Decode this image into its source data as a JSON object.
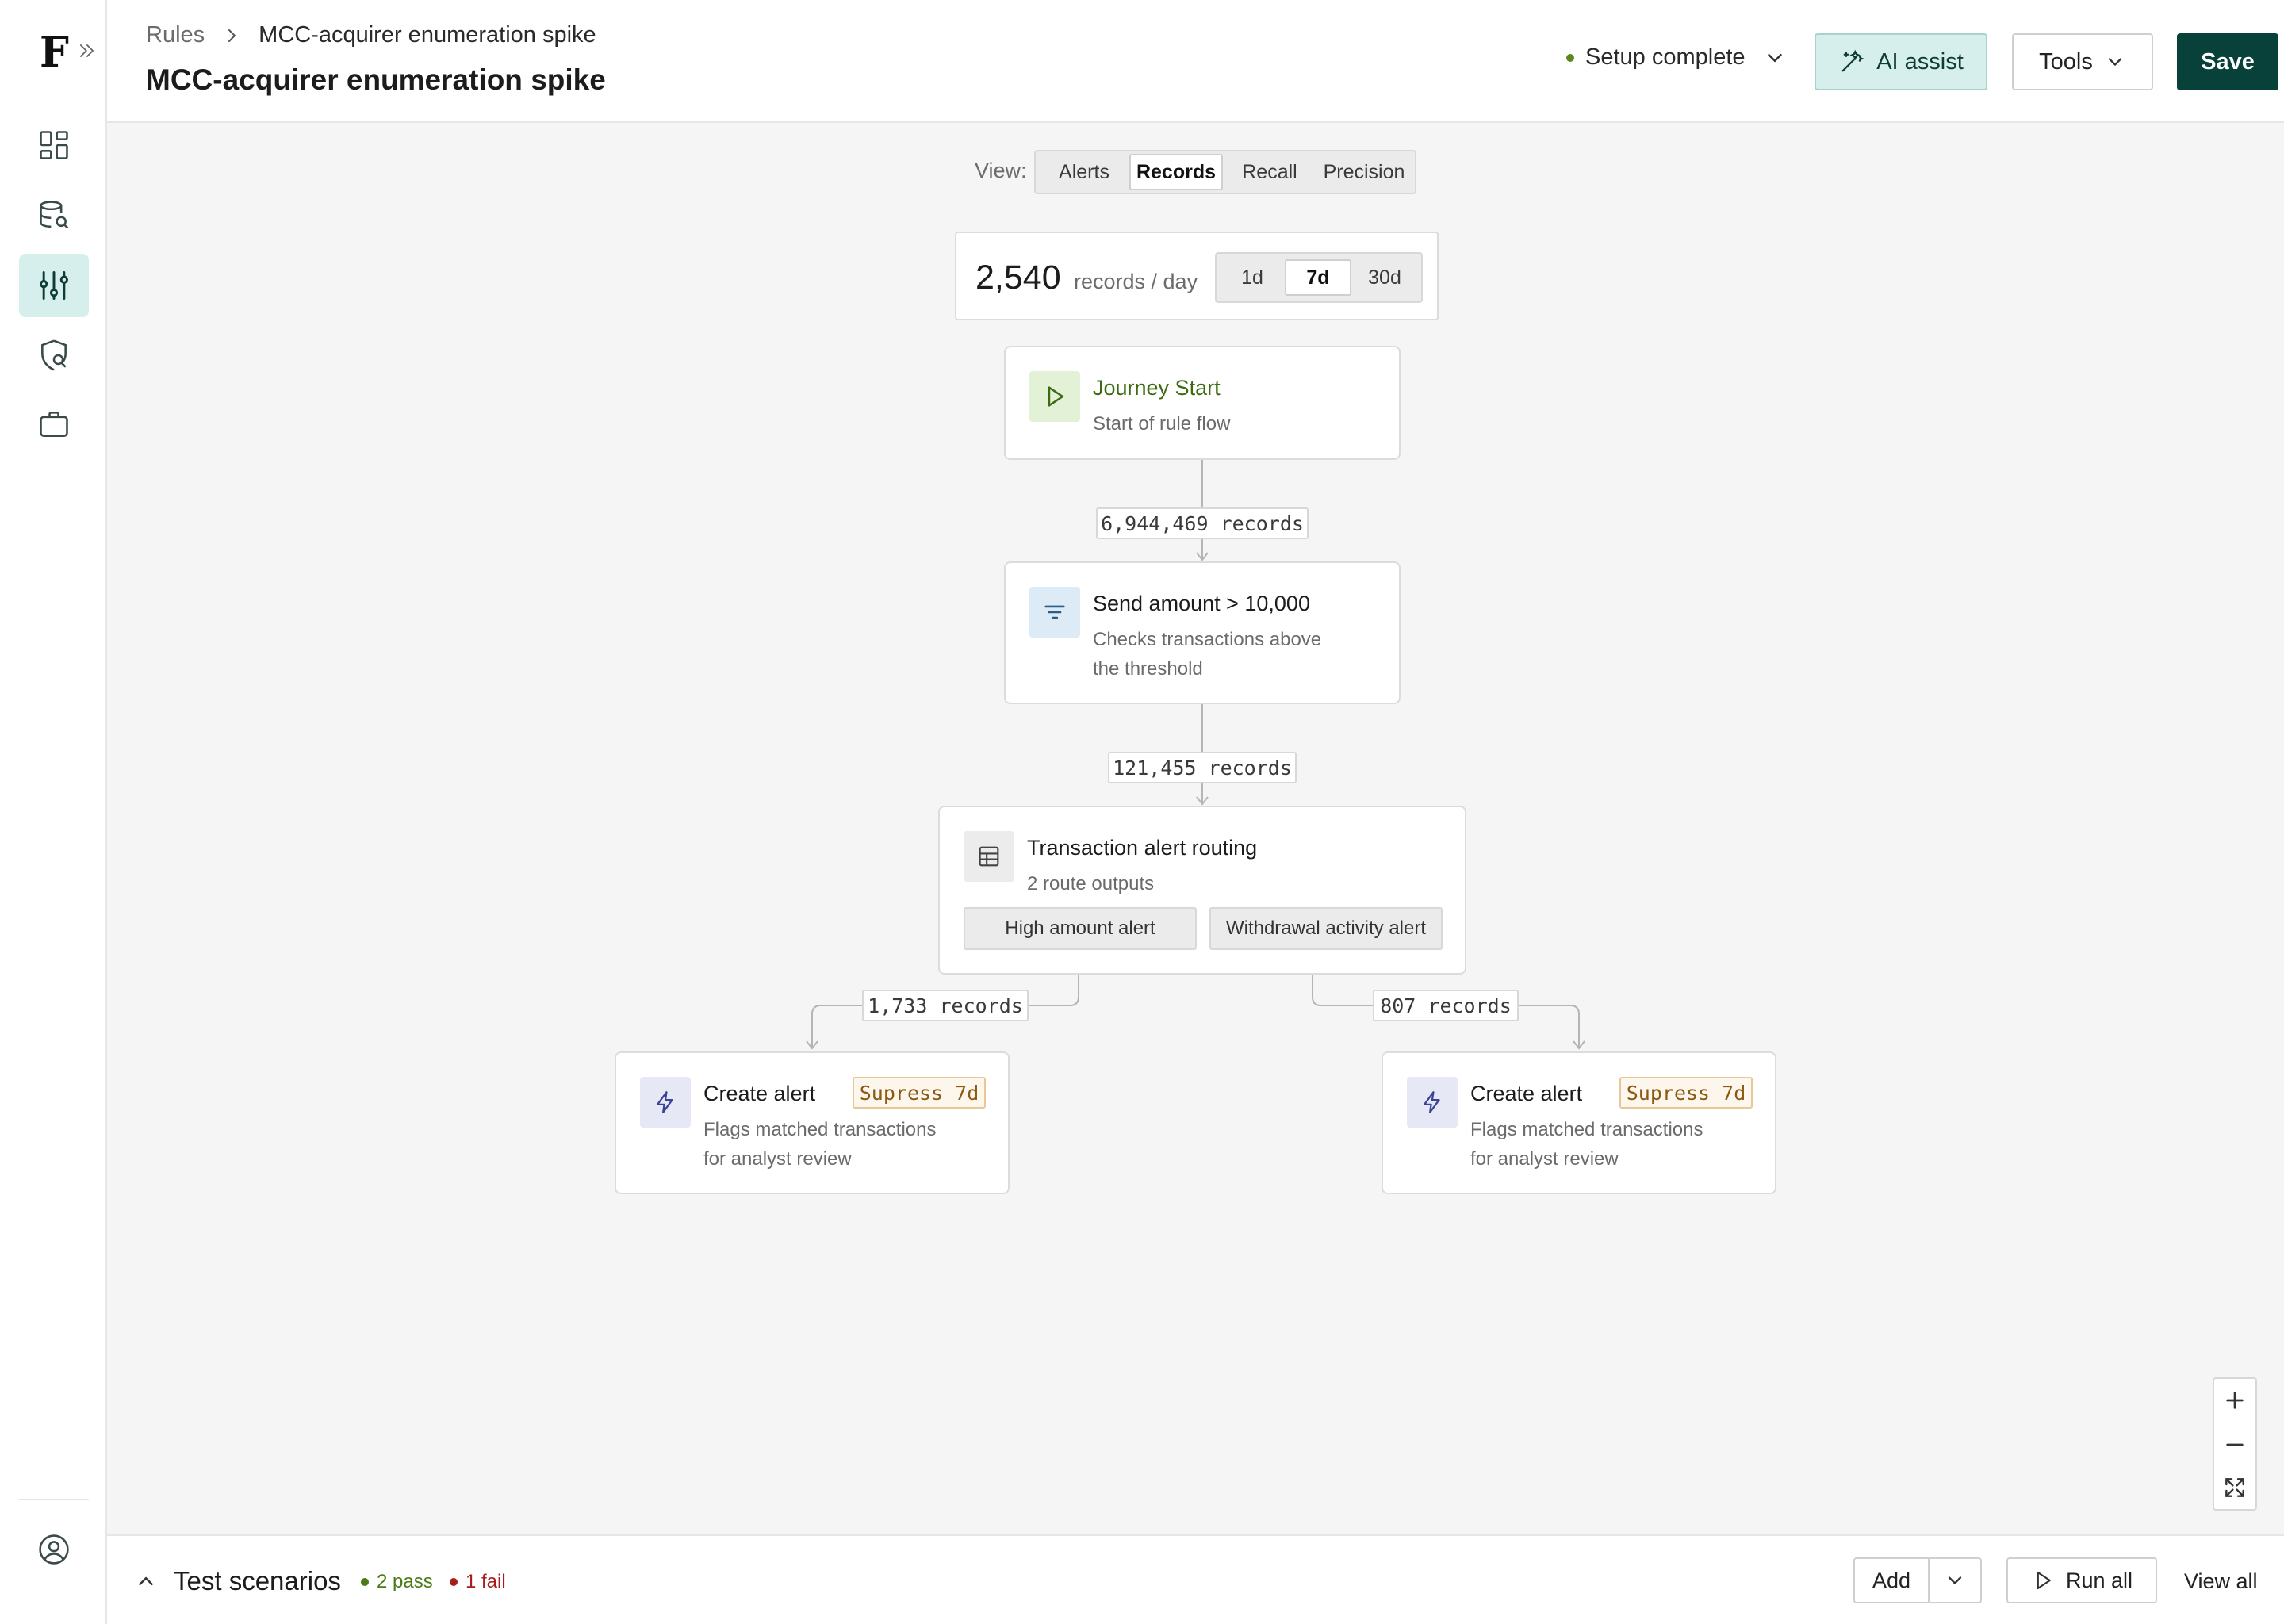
{
  "sidebar": {
    "logo": "F",
    "items": [
      {
        "name": "dashboard-icon",
        "active": false
      },
      {
        "name": "database-search-icon",
        "active": false
      },
      {
        "name": "sliders-icon",
        "active": true
      },
      {
        "name": "shield-search-icon",
        "active": false
      },
      {
        "name": "briefcase-icon",
        "active": false
      }
    ],
    "account_icon": "user-circle-icon",
    "accent_color": "#d6eeec"
  },
  "header": {
    "breadcrumb": {
      "root": "Rules",
      "current": "MCC-acquirer enumeration spike"
    },
    "title": "MCC-acquirer enumeration spike",
    "status": "Setup complete",
    "status_color": "#5a8a1f",
    "ai_assist": "AI assist",
    "tools": "Tools",
    "save": "Save",
    "save_color": "#08403a"
  },
  "view": {
    "label": "View:",
    "options": [
      "Alerts",
      "Records",
      "Recall",
      "Precision"
    ],
    "selected": "Records"
  },
  "stats": {
    "value": "2,540",
    "unit": "records / day",
    "ranges": [
      "1d",
      "7d",
      "30d"
    ],
    "selected_range": "7d"
  },
  "flow": {
    "start": {
      "title": "Journey Start",
      "subtitle": "Start of rule flow",
      "icon": "play-icon"
    },
    "count1": "6,944,469 records",
    "filter": {
      "title": "Send amount > 10,000",
      "subtitle_lines": [
        "Checks transactions above",
        "the threshold"
      ],
      "icon": "filter-icon"
    },
    "count2": "121,455 records",
    "router": {
      "title": "Transaction alert routing",
      "subtitle": "2 route outputs",
      "icon": "table-icon",
      "routes": [
        "High amount alert",
        "Withdrawal activity alert"
      ]
    },
    "count_left": "1,733 records",
    "count_right": "807 records",
    "alerts": [
      {
        "title": "Create alert",
        "badge": "Supress 7d",
        "subtitle_lines": [
          "Flags matched transactions",
          "for analyst review"
        ],
        "icon": "bolt-icon"
      },
      {
        "title": "Create alert",
        "badge": "Supress 7d",
        "subtitle_lines": [
          "Flags matched transactions",
          "for analyst review"
        ],
        "icon": "bolt-icon"
      }
    ]
  },
  "zoom": {
    "in": "plus-icon",
    "out": "minus-icon",
    "fit": "fit-screen-icon"
  },
  "test_scenarios": {
    "title": "Test scenarios",
    "pass": "2 pass",
    "fail": "1 fail",
    "pass_color": "#4b7a16",
    "fail_color": "#a61d1d",
    "add": "Add",
    "run_all": "Run all",
    "view_all": "View all"
  }
}
